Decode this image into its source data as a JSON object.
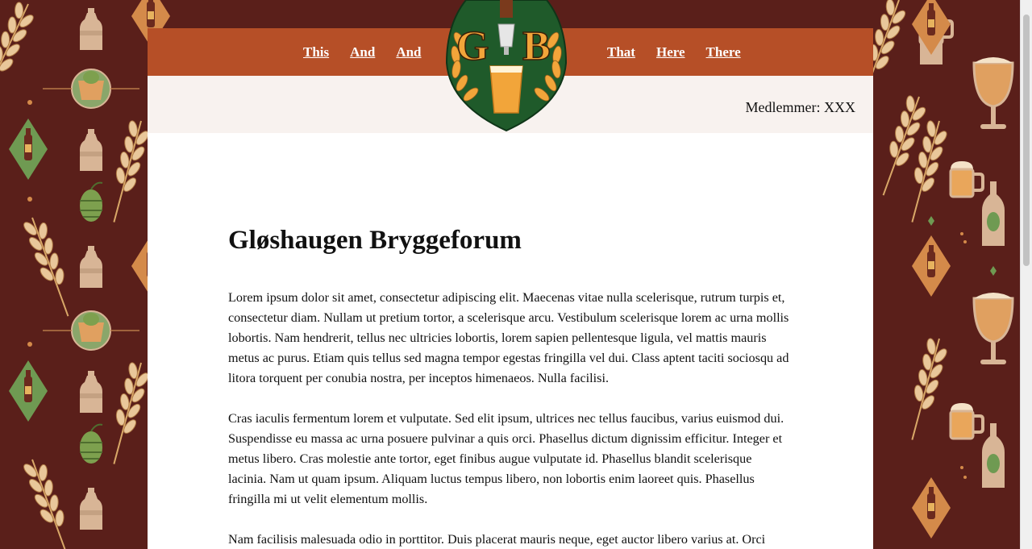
{
  "nav": {
    "left_links": [
      "This",
      "And",
      "And"
    ],
    "right_links": [
      "That",
      "Here",
      "There"
    ]
  },
  "logo": {
    "letter_left": "G",
    "letter_right": "B"
  },
  "members_text": "Medlemmer: XXX",
  "main": {
    "title": "Gløshaugen Bryggeforum",
    "paragraphs": [
      "Lorem ipsum dolor sit amet, consectetur adipiscing elit. Maecenas vitae nulla scelerisque, rutrum turpis et, consectetur diam. Nullam ut pretium tortor, a scelerisque arcu. Vestibulum scelerisque lorem ac urna mollis lobortis. Nam hendrerit, tellus nec ultricies lobortis, lorem sapien pellentesque ligula, vel mattis mauris metus ac purus. Etiam quis tellus sed magna tempor egestas fringilla vel dui. Class aptent taciti sociosqu ad litora torquent per conubia nostra, per inceptos himenaeos. Nulla facilisi.",
      "Cras iaculis fermentum lorem et vulputate. Sed elit ipsum, ultrices nec tellus faucibus, varius euismod dui. Suspendisse eu massa ac urna posuere pulvinar a quis orci. Phasellus dictum dignissim efficitur. Integer et metus libero. Cras molestie ante tortor, eget finibus augue vulputate id. Phasellus blandit scelerisque lacinia. Nam ut quam ipsum. Aliquam luctus tempus libero, non lobortis enim laoreet quis. Phasellus fringilla mi ut velit elementum mollis.",
      "Nam facilisis malesuada odio in porttitor. Duis placerat mauris neque, eget auctor libero varius at. Orci"
    ]
  },
  "colors": {
    "background": "#5a1f1a",
    "navbar": "#b64f27",
    "subbar": "#f8f2ef",
    "logo_green": "#1f5a2a",
    "logo_gold": "#f2a53a"
  },
  "icons": {
    "background_pattern": [
      "wheat-icon",
      "growler-icon",
      "bottle-icon",
      "beer-mug-icon",
      "hop-icon",
      "beer-glass-icon"
    ]
  }
}
